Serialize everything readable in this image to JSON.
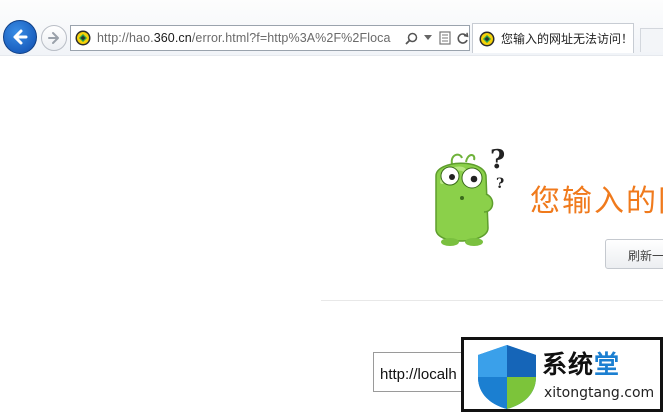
{
  "browser": {
    "address_url_prefix": "http://hao.",
    "address_url_domain": "360.cn",
    "address_url_rest": "/error.html?f=http%3A%2F%2Floca",
    "tab_title": "您输入的网址无法访问！",
    "tab_close": "×"
  },
  "error_page": {
    "title": "您输入的网",
    "refresh_label": "刷新一",
    "url_value": "http://localh"
  },
  "watermark": {
    "title_prefix": "系统",
    "title_accent": "堂",
    "domain": "xitongtang.com"
  },
  "colors": {
    "accent_orange": "#f07a1c",
    "back_button_blue": "#1a5fbf",
    "mascot_green": "#8bd04a",
    "watermark_blue": "#1b7fd1"
  }
}
